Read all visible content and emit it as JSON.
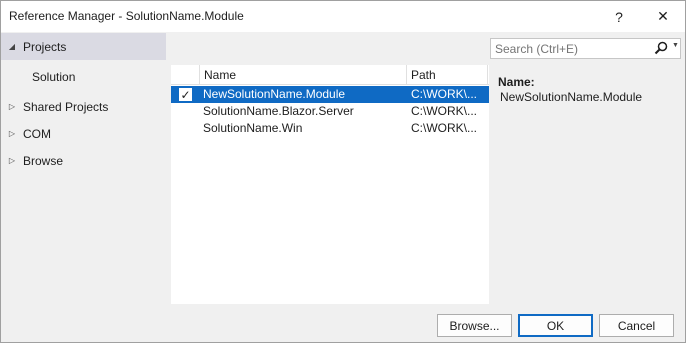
{
  "window": {
    "title": "Reference Manager - SolutionName.Module",
    "help_glyph": "?",
    "close_glyph": "✕"
  },
  "sidebar": {
    "items": [
      {
        "label": "Projects",
        "expanded": true,
        "selected": true
      },
      {
        "label": "Solution",
        "sub": true
      },
      {
        "label": "Shared Projects",
        "expanded": false
      },
      {
        "label": "COM",
        "expanded": false
      },
      {
        "label": "Browse",
        "expanded": false
      }
    ]
  },
  "list": {
    "columns": {
      "name": "Name",
      "path": "Path"
    },
    "rows": [
      {
        "name": "NewSolutionName.Module",
        "path": "C:\\WORK\\...",
        "checked": true,
        "selected": true
      },
      {
        "name": "SolutionName.Blazor.Server",
        "path": "C:\\WORK\\...",
        "checked": false,
        "selected": false
      },
      {
        "name": "SolutionName.Win",
        "path": "C:\\WORK\\...",
        "checked": false,
        "selected": false
      }
    ]
  },
  "search": {
    "placeholder": "Search (Ctrl+E)",
    "value": ""
  },
  "details": {
    "label": "Name:",
    "value": "NewSolutionName.Module"
  },
  "buttons": {
    "browse": "Browse...",
    "ok": "OK",
    "cancel": "Cancel"
  },
  "colors": {
    "selection": "#0f6ac4",
    "sidebar_selected": "#dadae3",
    "background": "#f0f0f0"
  }
}
